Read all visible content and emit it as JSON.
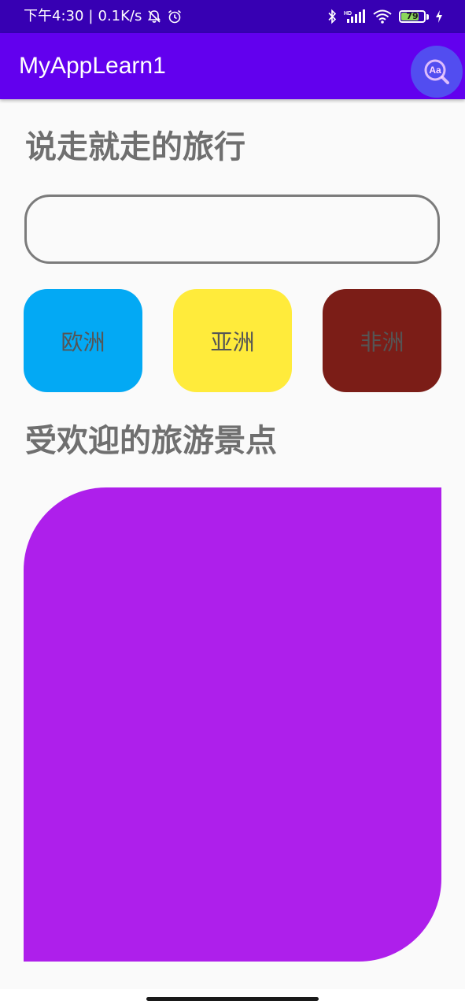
{
  "status_bar": {
    "time": "下午4:30",
    "separator": "|",
    "net_speed": "0.1K/s",
    "battery_level": "79",
    "battery_fraction": 0.79,
    "icons": [
      "bell-off-icon",
      "alarm-icon",
      "bluetooth-icon",
      "hd-signal-icon",
      "wifi-icon",
      "battery-icon",
      "charging-icon"
    ],
    "background": "#3700b3"
  },
  "app_bar": {
    "title": "MyAppLearn1",
    "background": "#6200ee",
    "float_icon": "text-size-icon",
    "float_label": "Aa"
  },
  "main": {
    "heading1": "说走就走的旅行",
    "search": {
      "value": "",
      "placeholder": ""
    },
    "buttons": [
      {
        "label": "欧洲",
        "color": "#03a9f4"
      },
      {
        "label": "亚洲",
        "color": "#ffeb3b"
      },
      {
        "label": "非洲",
        "color": "#7b1d17"
      }
    ],
    "heading2": "受欢迎的旅游景点",
    "banner_color": "#ae1feb"
  }
}
